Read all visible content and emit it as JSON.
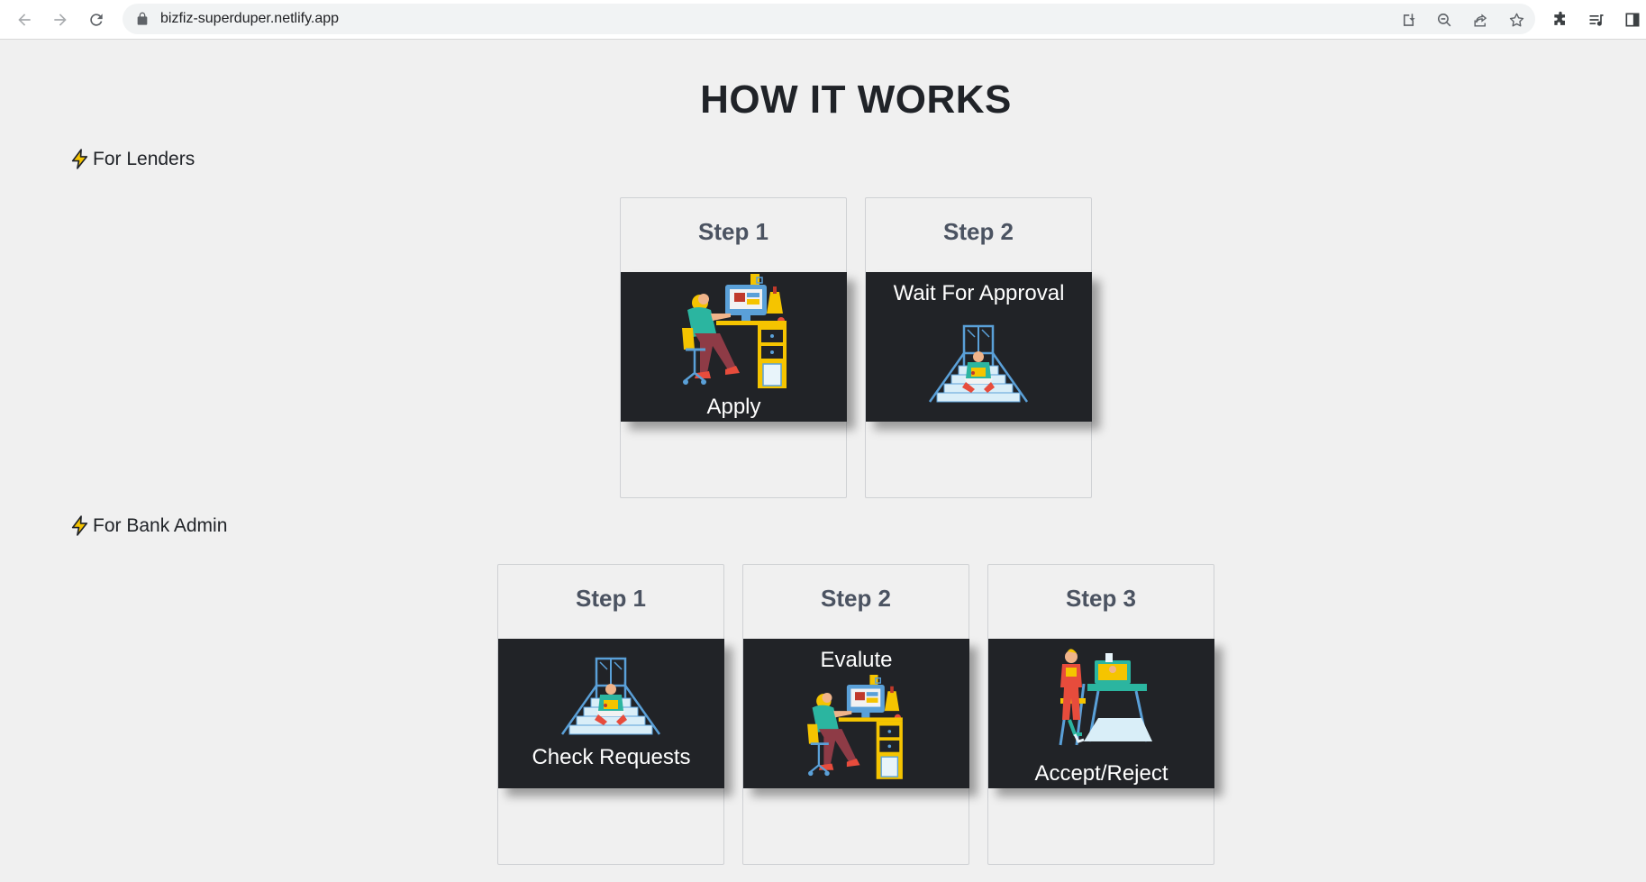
{
  "browser": {
    "url": "bizfiz-superduper.netlify.app"
  },
  "page": {
    "title": "HOW IT WORKS"
  },
  "lenders": {
    "label": "For Lenders",
    "steps": [
      {
        "step": "Step 1",
        "caption": "Apply",
        "illustration": "person-at-desk-illustration"
      },
      {
        "step": "Step 2",
        "caption": "Wait For Approval",
        "illustration": "person-on-stairs-illustration"
      }
    ]
  },
  "admin": {
    "label": "For Bank Admin",
    "steps": [
      {
        "step": "Step 1",
        "caption": "Check Requests",
        "illustration": "person-on-stairs-illustration"
      },
      {
        "step": "Step 2",
        "caption": "Evalute",
        "illustration": "person-at-desk-illustration"
      },
      {
        "step": "Step 3",
        "caption": "Accept/Reject",
        "illustration": "person-at-standing-desk-illustration"
      }
    ]
  },
  "colors": {
    "background": "#f0f0f0",
    "card_media": "#212327",
    "step_text": "#4b5361",
    "bolt": "#f5c400"
  }
}
